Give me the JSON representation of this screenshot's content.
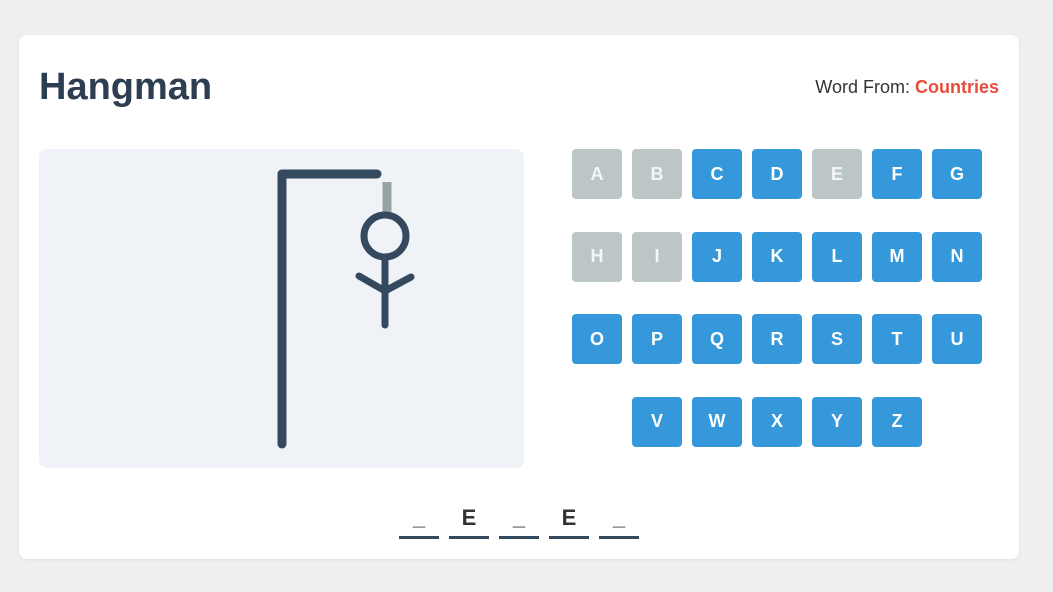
{
  "header": {
    "title": "Hangman",
    "category_label": "Word From: ",
    "category_value": "Countries"
  },
  "colors": {
    "key_active": "#3498db",
    "key_used": "#bdc6c7",
    "category": "#e74c3c",
    "title": "#2c3e50",
    "gallows": "#34495e",
    "rope": "#95a5a6"
  },
  "keyboard": {
    "rows": [
      [
        {
          "letter": "A",
          "used": true
        },
        {
          "letter": "B",
          "used": true
        },
        {
          "letter": "C",
          "used": false
        },
        {
          "letter": "D",
          "used": false
        },
        {
          "letter": "E",
          "used": true
        },
        {
          "letter": "F",
          "used": false
        },
        {
          "letter": "G",
          "used": false
        }
      ],
      [
        {
          "letter": "H",
          "used": true
        },
        {
          "letter": "I",
          "used": true
        },
        {
          "letter": "J",
          "used": false
        },
        {
          "letter": "K",
          "used": false
        },
        {
          "letter": "L",
          "used": false
        },
        {
          "letter": "M",
          "used": false
        },
        {
          "letter": "N",
          "used": false
        }
      ],
      [
        {
          "letter": "O",
          "used": false
        },
        {
          "letter": "P",
          "used": false
        },
        {
          "letter": "Q",
          "used": false
        },
        {
          "letter": "R",
          "used": false
        },
        {
          "letter": "S",
          "used": false
        },
        {
          "letter": "T",
          "used": false
        },
        {
          "letter": "U",
          "used": false
        }
      ],
      [
        {
          "letter": "V",
          "used": false
        },
        {
          "letter": "W",
          "used": false
        },
        {
          "letter": "X",
          "used": false
        },
        {
          "letter": "Y",
          "used": false
        },
        {
          "letter": "Z",
          "used": false
        }
      ]
    ]
  },
  "word": [
    "_",
    "E",
    "_",
    "E",
    "_"
  ]
}
